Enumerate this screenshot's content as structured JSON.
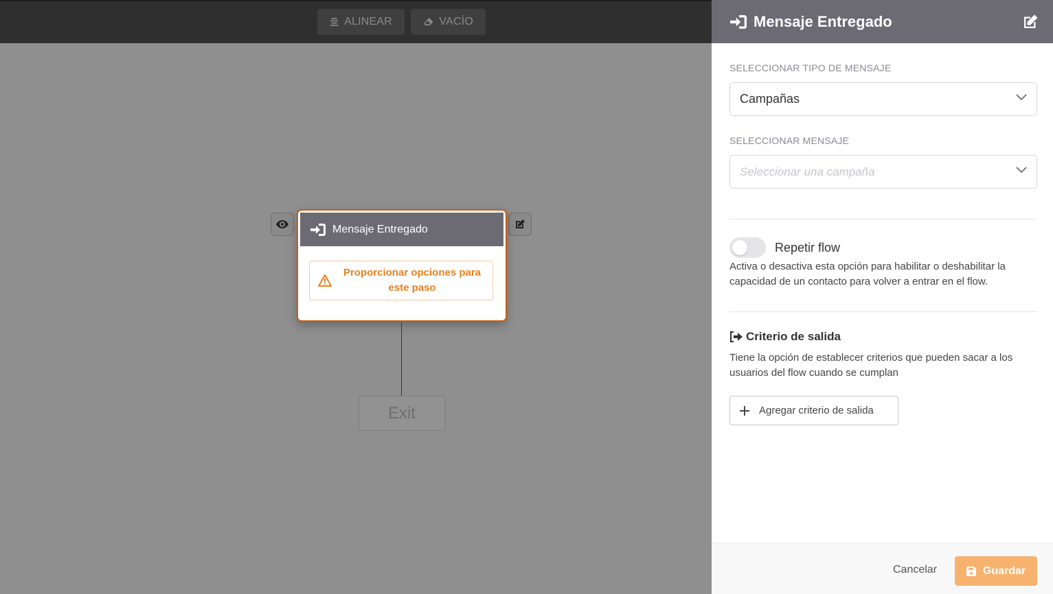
{
  "toolbar": {
    "align_label": "ALINEAR",
    "empty_label": "VACÍO"
  },
  "node": {
    "title": "Mensaje Entregado",
    "warning": "Proporcionar opciones para este paso"
  },
  "exit_node": {
    "label": "Exit"
  },
  "panel": {
    "title": "Mensaje Entregado",
    "message_type": {
      "label": "SELECCIONAR TIPO DE MENSAJE",
      "value": "Campañas"
    },
    "message": {
      "label": "SELECCIONAR MENSAJE",
      "placeholder": "Seleccionar una campaña"
    },
    "repeat": {
      "label": "Repetir flow",
      "enabled": false,
      "help": "Activa o desactiva esta opción para habilitar o deshabilitar la capacidad de un contacto para volver a entrar en el flow."
    },
    "exit_criteria": {
      "title": "Criterio de salida",
      "help": "Tiene la opción de establecer criterios que pueden sacar a los usuarios del flow cuando se cumplan",
      "add_label": "Agregar criterio de salida"
    },
    "footer": {
      "cancel_label": "Cancelar",
      "save_label": "Guardar"
    }
  },
  "colors": {
    "accent": "#c65d12",
    "warning_text": "#e7811f",
    "save_button": "#f7b26e",
    "header": "#6c6b74"
  }
}
